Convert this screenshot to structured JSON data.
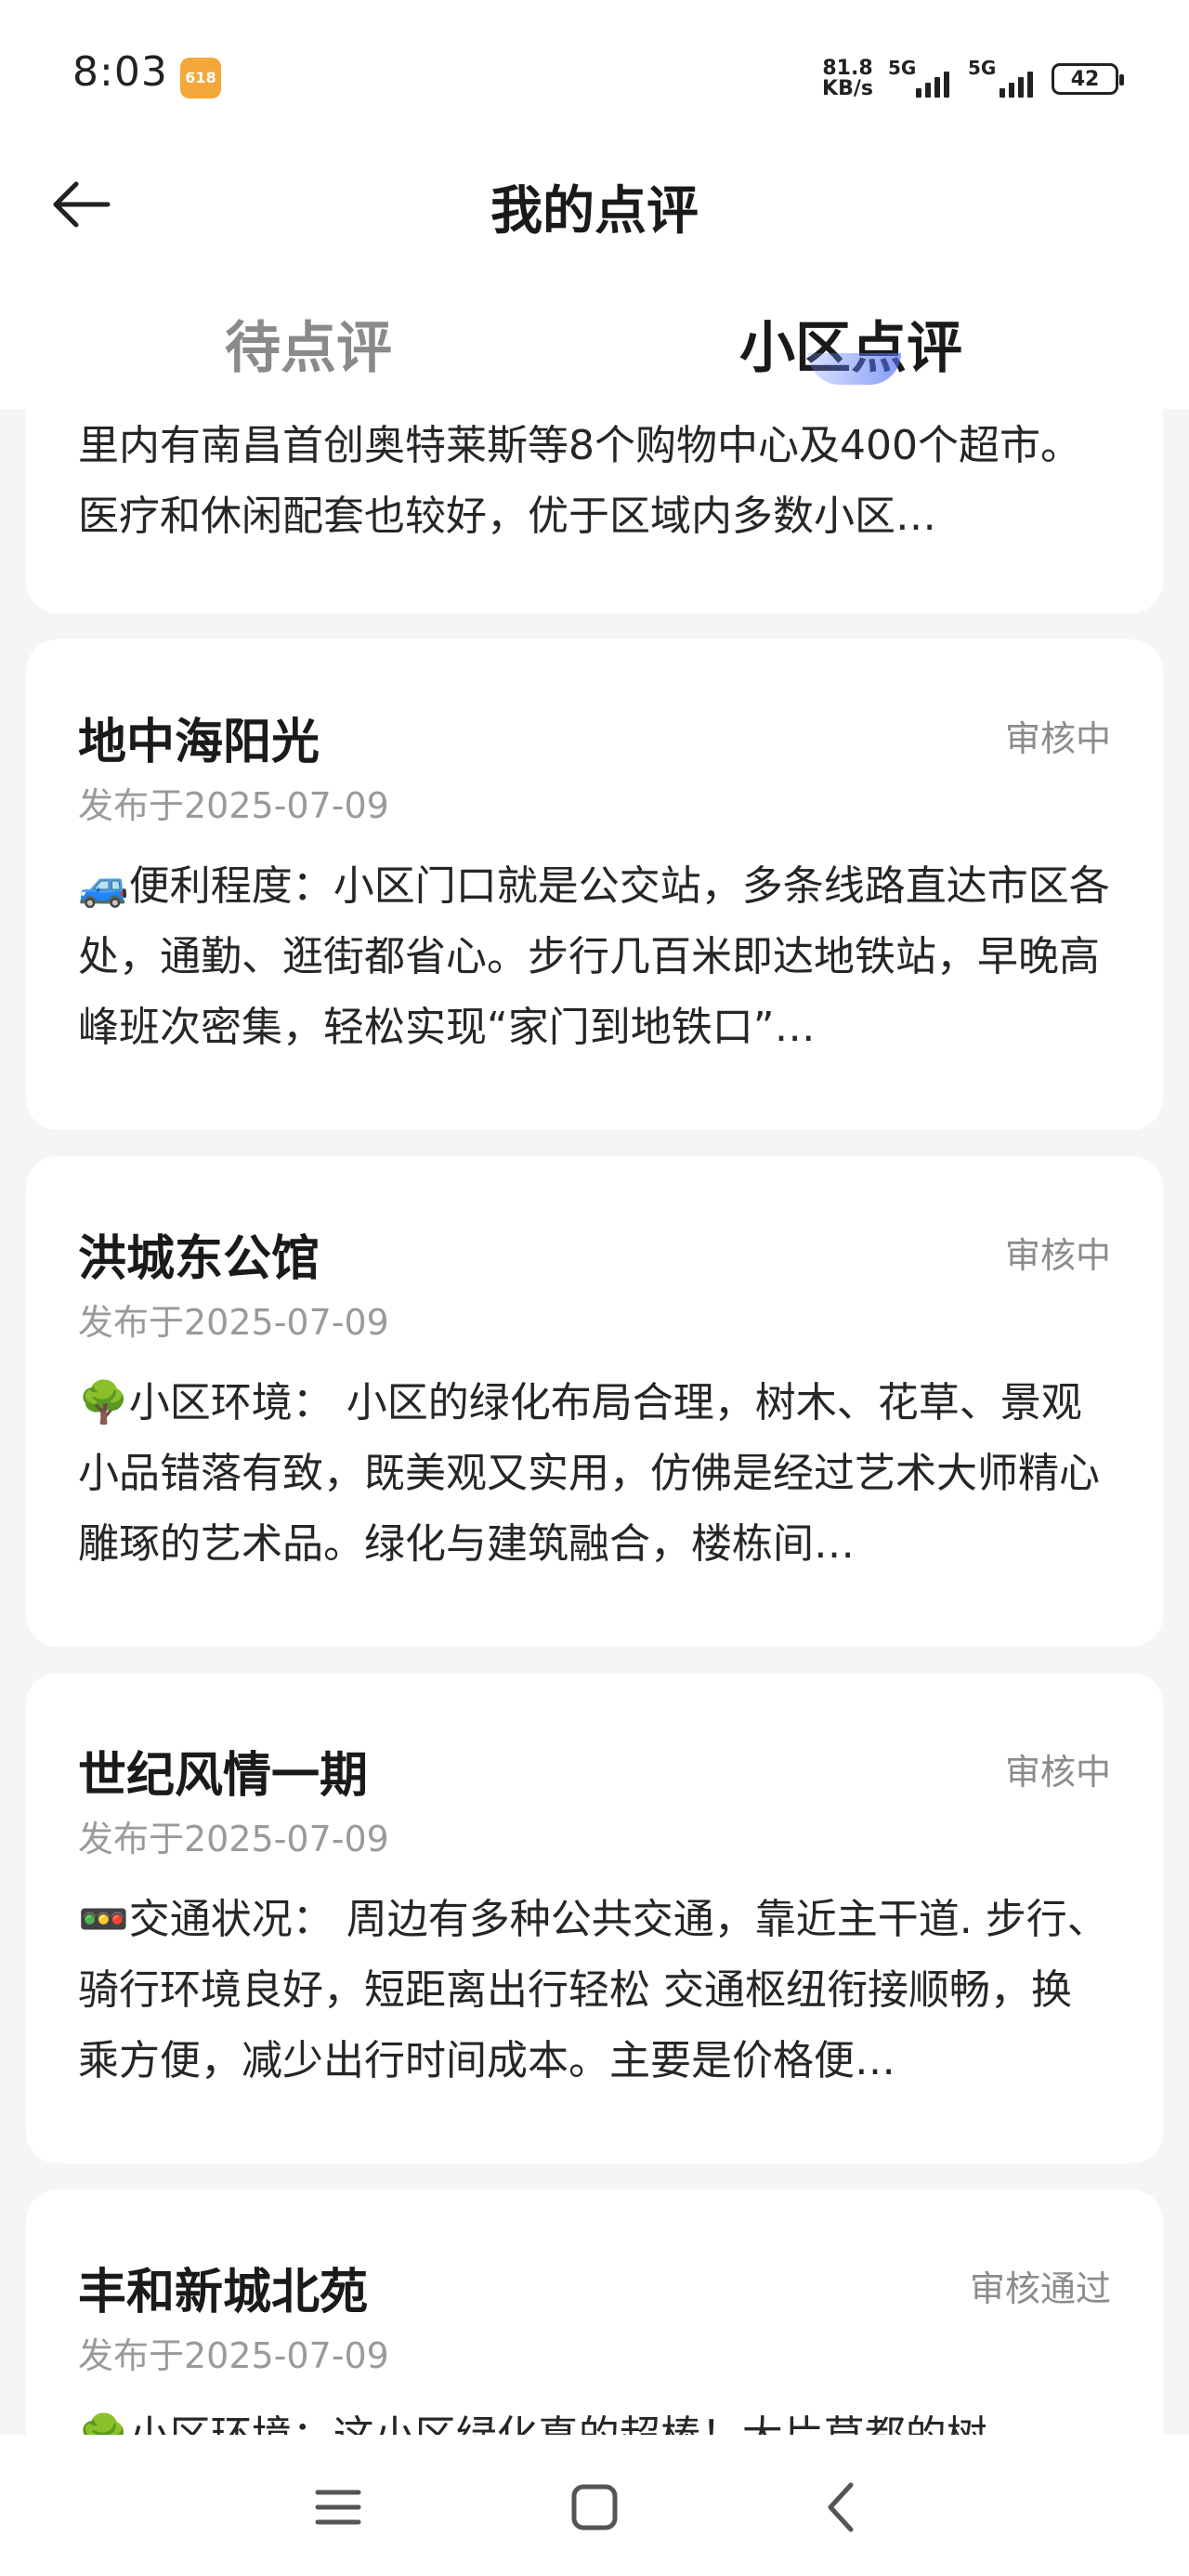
{
  "status_bar": {
    "time": "8:03",
    "app_icon_label": "618",
    "net_speed_value": "81.8",
    "net_speed_unit": "KB/s",
    "signal1_label": "5G",
    "signal2_label": "5G",
    "battery": "42"
  },
  "header": {
    "title": "我的点评"
  },
  "tabs": [
    {
      "label": "待点评",
      "active": false
    },
    {
      "label": "小区点评",
      "active": true
    }
  ],
  "reviews_partial": {
    "text": "里内有南昌首创奥特莱斯等8个购物中心及400个超市。医疗和休闲配套也较好，优于区域内多数小区…"
  },
  "reviews": [
    {
      "name": "地中海阳光",
      "status": "审核中",
      "date": "发布于2025-07-09",
      "text": "🚙便利程度：小区门口就是公交站，多条线路直达市区各处，通勤、逛街都省心。步行几百米即达地铁站，早晚高峰班次密集，轻松实现“家门到地铁口”…"
    },
    {
      "name": "洪城东公馆",
      "status": "审核中",
      "date": "发布于2025-07-09",
      "text": "🌳小区环境： 小区的绿化布局合理，树木、花草、景观小品错落有致，既美观又实用，仿佛是经过艺术大师精心雕琢的艺术品。绿化与建筑融合，楼栋间…"
    },
    {
      "name": "世纪风情一期",
      "status": "审核中",
      "date": "发布于2025-07-09",
      "text": "🚥交通状况： 周边有多种公共交通，靠近主干道. 步行、骑行环境良好，短距离出行轻松 交通枢纽衔接顺畅，换乘方便，减少出行时间成本。主要是价格便…"
    },
    {
      "name": "丰和新城北苑",
      "status": "审核通过",
      "date": "发布于2025-07-09",
      "text": "🌳小区环境：这小区绿化真的超棒！大片草都的树…"
    }
  ],
  "icons": {
    "back": "arrow-left-icon",
    "menu": "menu-icon",
    "home": "home-icon",
    "nav_back": "chevron-left-icon"
  }
}
